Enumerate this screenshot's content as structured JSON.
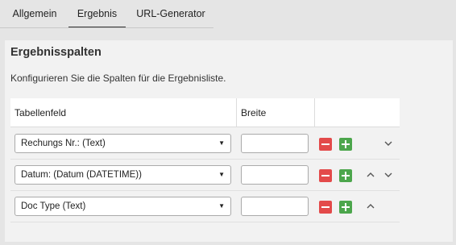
{
  "tabs": [
    {
      "label": "Allgemein",
      "active": false
    },
    {
      "label": "Ergebnis",
      "active": true
    },
    {
      "label": "URL-Generator",
      "active": false
    }
  ],
  "panel": {
    "title": "Ergebnisspalten",
    "description": "Konfigurieren Sie die Spalten für die Ergebnisliste."
  },
  "table": {
    "headers": {
      "field": "Tabellenfeld",
      "width": "Breite",
      "actions": ""
    },
    "rows": [
      {
        "field": "Rechungs Nr.: (Text)",
        "width": "",
        "can_move_up": false,
        "can_move_down": true
      },
      {
        "field": "Datum: (Datum (DATETIME))",
        "width": "",
        "can_move_up": true,
        "can_move_down": true
      },
      {
        "field": "Doc Type (Text)",
        "width": "",
        "can_move_up": true,
        "can_move_down": false
      }
    ]
  },
  "icons": {
    "remove": "minus-icon",
    "add": "plus-icon",
    "up": "chevron-up-icon",
    "down": "chevron-down-icon",
    "dropdown": "caret-down-icon"
  },
  "colors": {
    "remove_button": "#e34a4a",
    "add_button": "#4ca64c",
    "panel_background": "#f2f2f2",
    "page_background": "#e5e5e5"
  }
}
